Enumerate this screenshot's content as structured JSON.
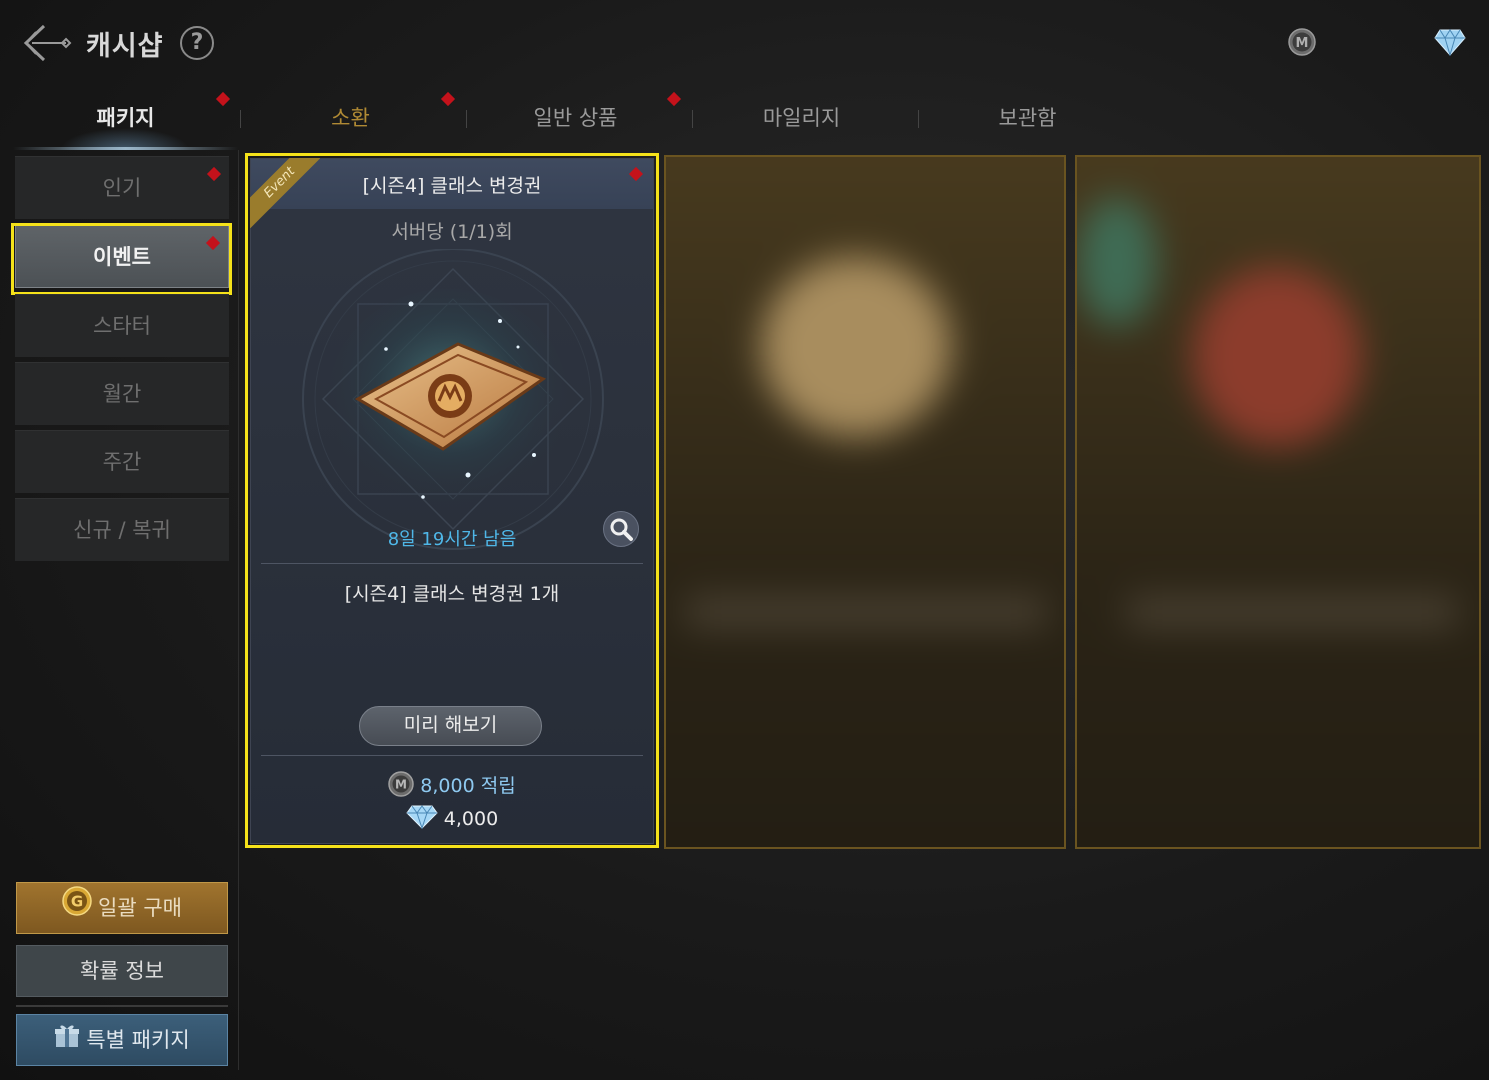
{
  "header": {
    "title": "캐시샵",
    "help_label": "?"
  },
  "tabs": [
    {
      "label": "패키지",
      "active": true,
      "has_new": true
    },
    {
      "label": "소환",
      "active": false,
      "has_new": true
    },
    {
      "label": "일반 상품",
      "active": false,
      "has_new": true
    },
    {
      "label": "마일리지",
      "active": false,
      "has_new": false
    },
    {
      "label": "보관함",
      "active": false,
      "has_new": false
    }
  ],
  "sidebar": {
    "items": [
      {
        "label": "인기",
        "has_new": true
      },
      {
        "label": "이벤트",
        "has_new": true,
        "active": true
      },
      {
        "label": "스타터"
      },
      {
        "label": "월간"
      },
      {
        "label": "주간"
      },
      {
        "label": "신규 / 복귀"
      }
    ],
    "bulk_buy_label": "일괄 구매",
    "probability_label": "확률 정보",
    "special_package_label": "특별 패키지",
    "bulk_icon_letter": "G"
  },
  "product": {
    "ribbon": "Event",
    "title": "[시즌4] 클래스 변경권",
    "limit": "서버당  (1/1)회",
    "timer": "8일 19시간 남음",
    "item": "[시즌4] 클래스 변경권 1개",
    "preview_label": "미리 해보기",
    "mileage": "8,000 적립",
    "price": "4,000",
    "mileage_icon_letter": "M"
  },
  "currency": {
    "mileage_icon_letter": "M"
  },
  "colors": {
    "highlight": "#f5e21a",
    "new_dot": "#c4121b",
    "timer": "#4fb7e8",
    "gold_tab": "#b08a34"
  }
}
